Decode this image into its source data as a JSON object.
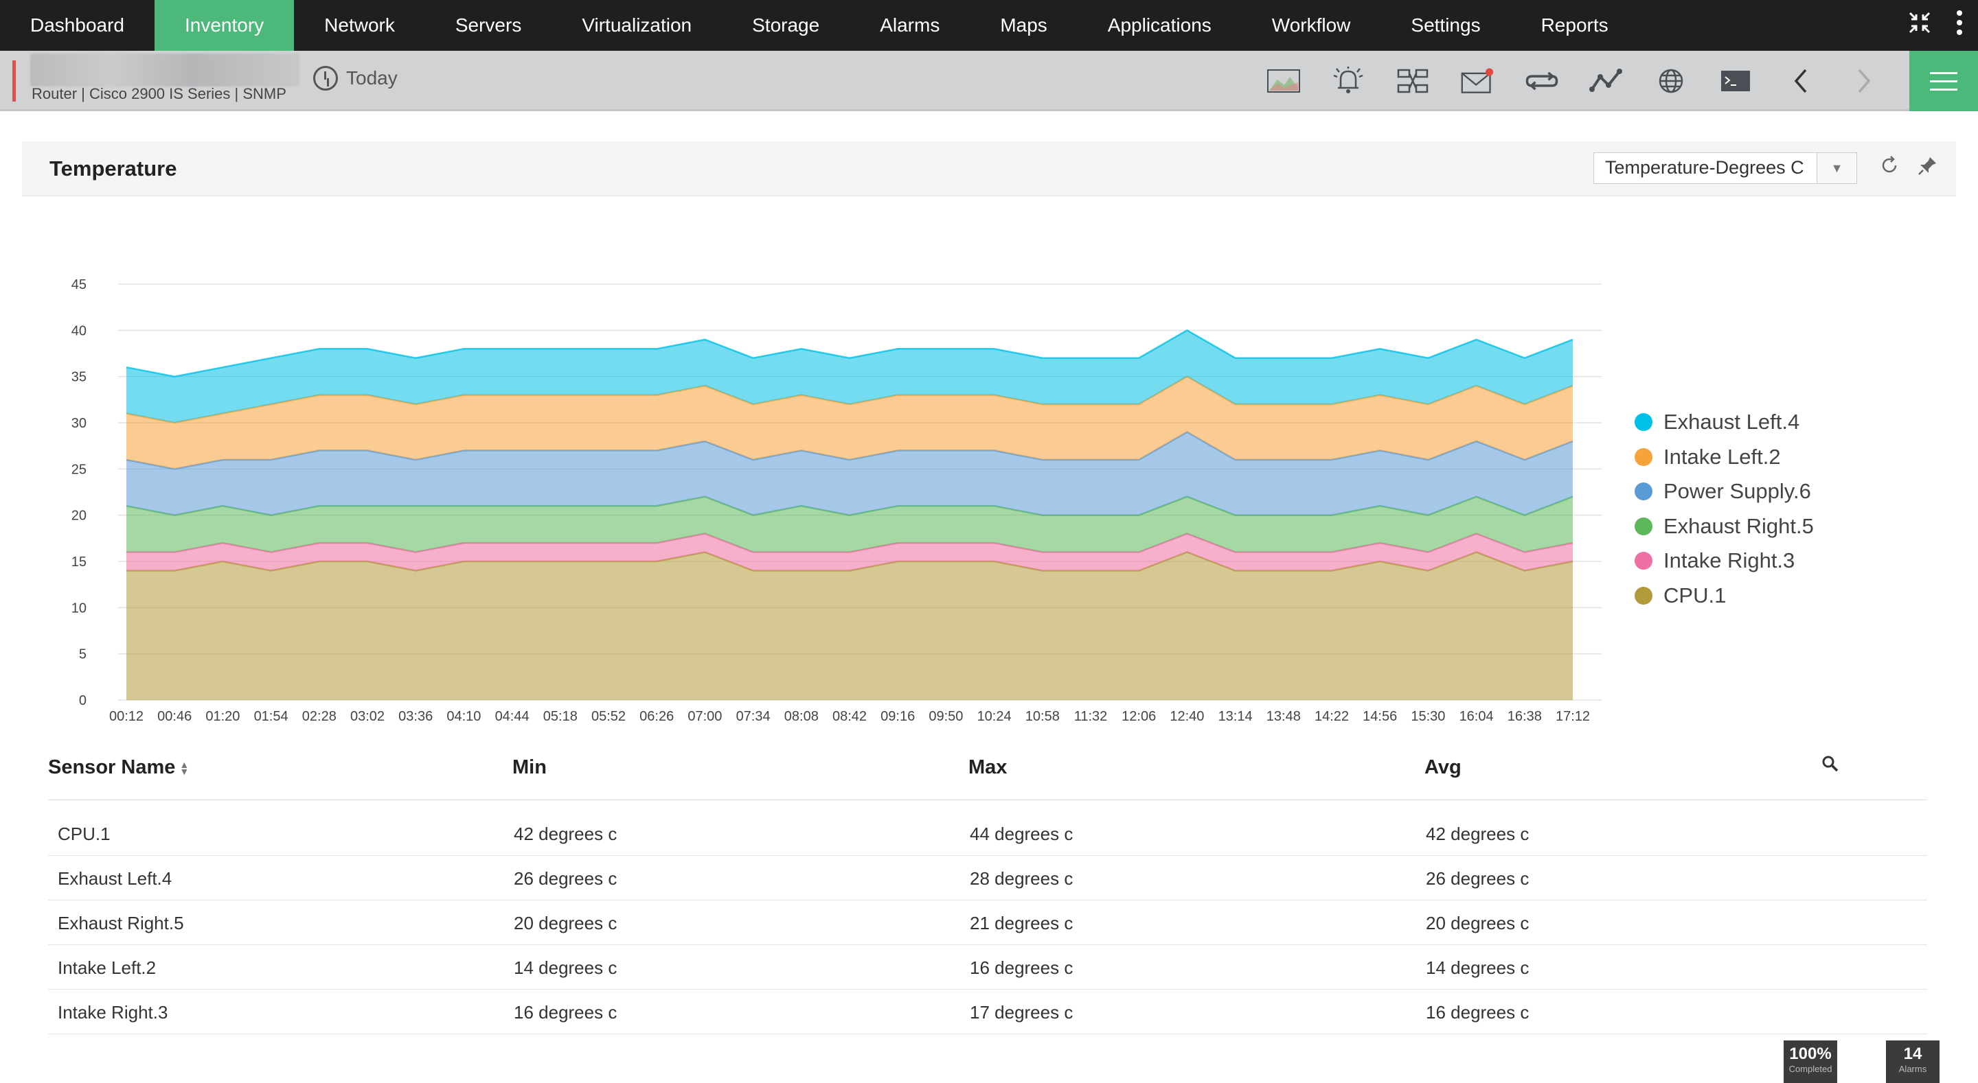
{
  "nav": {
    "items": [
      "Dashboard",
      "Inventory",
      "Network",
      "Servers",
      "Virtualization",
      "Storage",
      "Alarms",
      "Maps",
      "Applications",
      "Workflow",
      "Settings",
      "Reports"
    ],
    "active": "Inventory"
  },
  "device": {
    "info": "Router | Cisco 2900 IS Series  | SNMP",
    "period": "Today"
  },
  "panel": {
    "title": "Temperature",
    "select_value": "Temperature-Degrees C"
  },
  "chart_data": {
    "type": "area",
    "stacked": true,
    "x": [
      "00:12",
      "00:46",
      "01:20",
      "01:54",
      "02:28",
      "03:02",
      "03:36",
      "04:10",
      "04:44",
      "05:18",
      "05:52",
      "06:26",
      "07:00",
      "07:34",
      "08:08",
      "08:42",
      "09:16",
      "09:50",
      "10:24",
      "10:58",
      "11:32",
      "12:06",
      "12:40",
      "13:14",
      "13:48",
      "14:22",
      "14:56",
      "15:30",
      "16:04",
      "16:38",
      "17:12"
    ],
    "ylim": [
      0,
      45
    ],
    "yticks": [
      0,
      5,
      10,
      15,
      20,
      25,
      30,
      35,
      40,
      45
    ],
    "grid": true,
    "legend_position": "right",
    "series": [
      {
        "name": "Exhaust Left.4",
        "color": "#00c0e6",
        "values": [
          5,
          5,
          5,
          5,
          5,
          5,
          5,
          5,
          5,
          5,
          5,
          5,
          5,
          5,
          5,
          5,
          5,
          5,
          5,
          5,
          5,
          5,
          5,
          5,
          5,
          5,
          5,
          5,
          5,
          5,
          5
        ]
      },
      {
        "name": "Intake Left.2",
        "color": "#f5a33a",
        "values": [
          5,
          5,
          5,
          6,
          6,
          6,
          6,
          6,
          6,
          6,
          6,
          6,
          6,
          6,
          6,
          6,
          6,
          6,
          6,
          6,
          6,
          6,
          6,
          6,
          6,
          6,
          6,
          6,
          6,
          6,
          6
        ]
      },
      {
        "name": "Power Supply.6",
        "color": "#5b9bd5",
        "values": [
          5,
          5,
          5,
          6,
          6,
          6,
          5,
          6,
          6,
          6,
          6,
          6,
          6,
          6,
          6,
          6,
          6,
          6,
          6,
          6,
          6,
          6,
          7,
          6,
          6,
          6,
          6,
          6,
          6,
          6,
          6
        ]
      },
      {
        "name": "Exhaust Right.5",
        "color": "#5cb85c",
        "values": [
          5,
          4,
          4,
          4,
          4,
          4,
          5,
          4,
          4,
          4,
          4,
          4,
          4,
          4,
          5,
          4,
          4,
          4,
          4,
          4,
          4,
          4,
          4,
          4,
          4,
          4,
          4,
          4,
          4,
          4,
          5
        ]
      },
      {
        "name": "Intake Right.3",
        "color": "#ef6fa3",
        "values": [
          2,
          2,
          2,
          2,
          2,
          2,
          2,
          2,
          2,
          2,
          2,
          2,
          2,
          2,
          2,
          2,
          2,
          2,
          2,
          2,
          2,
          2,
          2,
          2,
          2,
          2,
          2,
          2,
          2,
          2,
          2
        ]
      },
      {
        "name": "CPU.1",
        "color": "#b29a3a",
        "values": [
          14,
          14,
          15,
          14,
          15,
          15,
          14,
          15,
          15,
          15,
          15,
          15,
          16,
          14,
          14,
          14,
          15,
          15,
          15,
          14,
          14,
          14,
          16,
          14,
          14,
          14,
          15,
          14,
          16,
          14,
          15
        ]
      }
    ]
  },
  "table": {
    "headers": [
      "Sensor Name",
      "Min",
      "Max",
      "Avg"
    ],
    "rows": [
      [
        "CPU.1",
        "42 degrees c",
        "44 degrees c",
        "42 degrees c"
      ],
      [
        "Exhaust Left.4",
        "26 degrees c",
        "28 degrees c",
        "26 degrees c"
      ],
      [
        "Exhaust Right.5",
        "20 degrees c",
        "21 degrees c",
        "20 degrees c"
      ],
      [
        "Intake Left.2",
        "14 degrees c",
        "16 degrees c",
        "14 degrees c"
      ],
      [
        "Intake Right.3",
        "16 degrees c",
        "17 degrees c",
        "16 degrees c"
      ]
    ]
  },
  "status": {
    "progress": "100%",
    "progress_label": "Completed",
    "alarms_count": "14",
    "alarms_label": "Alarms"
  }
}
